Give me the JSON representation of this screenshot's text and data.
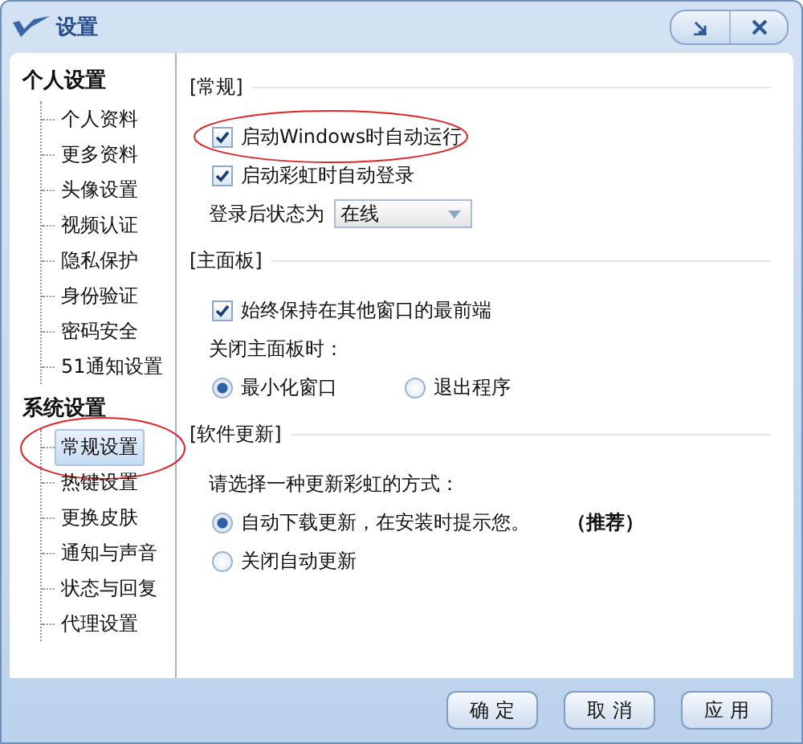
{
  "window": {
    "title": "设置"
  },
  "sidebar": {
    "groups": [
      {
        "label": "个人设置",
        "items": [
          {
            "label": "个人资料",
            "selected": false,
            "circled": false
          },
          {
            "label": "更多资料",
            "selected": false,
            "circled": false
          },
          {
            "label": "头像设置",
            "selected": false,
            "circled": false
          },
          {
            "label": "视频认证",
            "selected": false,
            "circled": false
          },
          {
            "label": "隐私保护",
            "selected": false,
            "circled": false
          },
          {
            "label": "身份验证",
            "selected": false,
            "circled": false
          },
          {
            "label": "密码安全",
            "selected": false,
            "circled": false
          },
          {
            "label": "51通知设置",
            "selected": false,
            "circled": false
          }
        ]
      },
      {
        "label": "系统设置",
        "items": [
          {
            "label": "常规设置",
            "selected": true,
            "circled": true
          },
          {
            "label": "热键设置",
            "selected": false,
            "circled": false
          },
          {
            "label": "更换皮肤",
            "selected": false,
            "circled": false
          },
          {
            "label": "通知与声音",
            "selected": false,
            "circled": false
          },
          {
            "label": "状态与回复",
            "selected": false,
            "circled": false
          },
          {
            "label": "代理设置",
            "selected": false,
            "circled": false
          }
        ]
      }
    ]
  },
  "sections": [
    {
      "title": "[常规]",
      "items": [
        {
          "kind": "checkbox",
          "label": "启动Windows时自动运行",
          "checked": true,
          "circled": true
        },
        {
          "kind": "checkbox",
          "label": "启动彩虹时自动登录",
          "checked": true,
          "circled": false
        },
        {
          "kind": "select",
          "label": "登录后状态为",
          "value": "在线"
        }
      ]
    },
    {
      "title": "[主面板]",
      "items": [
        {
          "kind": "checkbox",
          "label": "始终保持在其他窗口的最前端",
          "checked": true,
          "circled": false
        },
        {
          "kind": "text",
          "label": "关闭主面板时："
        },
        {
          "kind": "radio_row",
          "options": [
            {
              "label": "最小化窗口",
              "selected": true
            },
            {
              "label": "退出程序",
              "selected": false
            }
          ]
        }
      ]
    },
    {
      "title": "[软件更新]",
      "items": [
        {
          "kind": "text",
          "label": "请选择一种更新彩虹的方式："
        },
        {
          "kind": "radio",
          "label": "自动下载更新，在安装时提示您。",
          "note": "（推荐）",
          "selected": true
        },
        {
          "kind": "radio",
          "label": "关闭自动更新",
          "selected": false
        }
      ]
    }
  ],
  "buttons": [
    "确 定",
    "取 消",
    "应 用"
  ]
}
